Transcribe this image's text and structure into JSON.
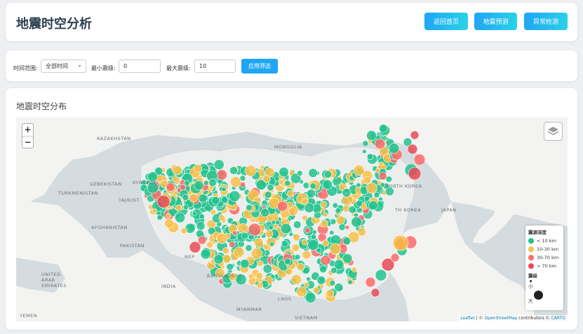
{
  "header": {
    "title": "地震时空分析",
    "buttons": [
      "返回首页",
      "地震预测",
      "异常检测"
    ]
  },
  "filter": {
    "time_label": "时间范围:",
    "time_value": "全部时间",
    "min_label": "最小震级:",
    "min_value": "0",
    "max_label": "最大震级:",
    "max_value": "10",
    "apply_label": "应用筛选"
  },
  "map": {
    "title": "地震时空分布",
    "zoom_in": "+",
    "zoom_out": "−",
    "labels": [
      "KAZAKHSTAN",
      "MONGOLIA",
      "UZBEKISTAN",
      "KYRGYZS",
      "TURKMENISTAN",
      "TAJIKIST",
      "AFGHANISTAN",
      "PAKISTAN",
      "NORTH KOREA",
      "TH KOREA",
      "JAPAN",
      "NEP",
      "INDIA",
      "BANGLADESH",
      "MYANMAR",
      "LAOS",
      "VIETNAM",
      "UNITED ARAB EMIRATES",
      "YEMEN"
    ],
    "legend": {
      "depth_title": "震源深度",
      "depth_items": [
        "< 10 km",
        "10-30 km",
        "30-70 km",
        "> 70 km"
      ],
      "mag_title": "震级",
      "mag_small": "小",
      "mag_large": "大"
    },
    "attribution": {
      "leaflet": "Leaflet",
      "sep1": " | © ",
      "osm": "OpenStreetMap",
      "mid": " contributors © ",
      "carto": "CARTO"
    }
  },
  "colors": {
    "shallow": "#21c28e",
    "mid": "#f9c04a",
    "deep": "#fd6a6a",
    "deepest": "#e94a55",
    "button": "#1fa6f5"
  }
}
